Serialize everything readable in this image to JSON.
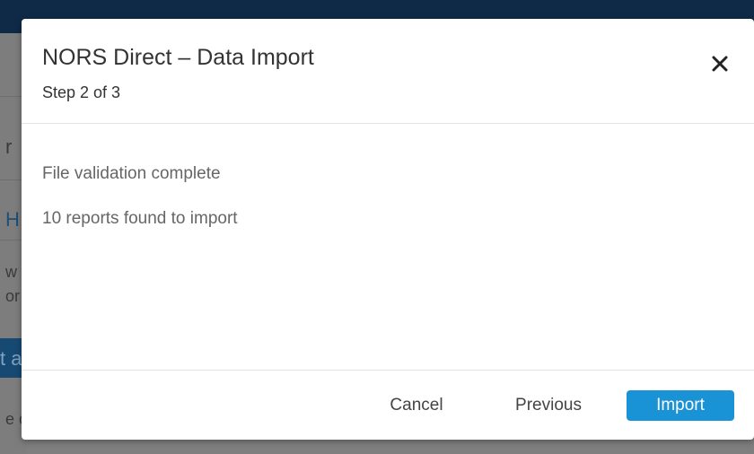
{
  "background_page": {
    "fragments": [
      "r",
      "H",
      "w",
      "or",
      "t a",
      "e c"
    ]
  },
  "modal": {
    "title": "NORS Direct – Data Import",
    "subtitle": "Step 2 of 3",
    "close_icon": "close-icon",
    "body_lines": [
      "File validation complete",
      "10 reports found to import"
    ],
    "footer": {
      "cancel_label": "Cancel",
      "previous_label": "Previous",
      "import_label": "Import"
    }
  },
  "colors": {
    "primary_button": "#1a93d6",
    "top_bar": "#0f2a47",
    "overlay": "#7f7f7f"
  }
}
